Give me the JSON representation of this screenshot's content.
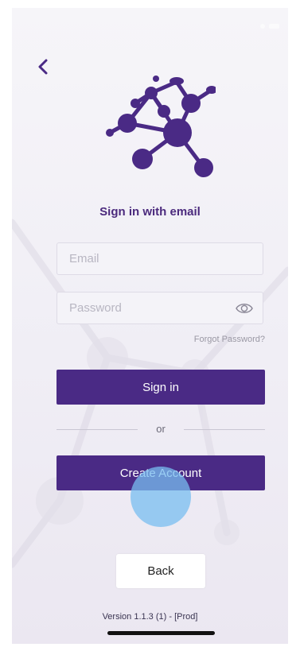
{
  "colors": {
    "accent": "#4a2a85",
    "title": "#4b2a7d",
    "background": "#f2f0f6"
  },
  "header": {
    "back_icon": "chevron-left-icon",
    "logo_icon": "molecule-network-logo"
  },
  "form": {
    "title": "Sign in with email",
    "email_placeholder": "Email",
    "email_value": "",
    "password_placeholder": "Password",
    "password_value": "",
    "password_toggle_icon": "eye-icon",
    "forgot_label": "Forgot Password?"
  },
  "actions": {
    "signin_label": "Sign in",
    "or_label": "or",
    "create_label": "Create Account",
    "back_label": "Back"
  },
  "footer": {
    "version": "Version 1.1.3 (1) - [Prod]"
  }
}
